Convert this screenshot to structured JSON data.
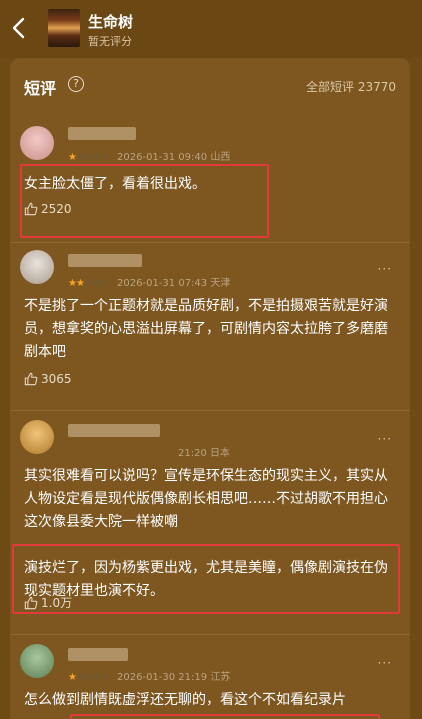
{
  "header": {
    "title": "生命树",
    "subtitle": "暂无评分"
  },
  "section": {
    "title": "短评",
    "all_label": "全部短评",
    "all_count": "23770"
  },
  "reviews": [
    {
      "stars_filled": 1,
      "date": "2026-01-31 09:40",
      "location": "山西",
      "text": "女主脸太僵了，看着很出戏。",
      "likes": "2520"
    },
    {
      "stars_filled": 2,
      "date": "2026-01-31 07:43",
      "location": "天津",
      "text": "不是挑了一个正题材就是品质好剧，不是拍摄艰苦就是好演员，想拿奖的心思溢出屏幕了，可剧情内容太拉胯了多磨磨剧本吧",
      "likes": "3065"
    },
    {
      "stars_filled": 0,
      "date": "21:20",
      "location": "日本",
      "text_a": "其实很难看可以说吗？宣传是环保生态的现实主义，其实从人物设定看是现代版偶像剧长相思吧……不过胡歌不用担心这次像县委大院一样被嘲",
      "text_b": "演技烂了，因为杨紫更出戏，尤其是美瞳，偶像剧演技在伪现实题材里也演不好。",
      "likes": "1.0万"
    },
    {
      "stars_filled": 1,
      "date": "2026-01-30 21:19",
      "location": "江苏",
      "text": "怎么做到剧情既虚浮还无聊的，看这个不如看纪录片",
      "likes": ""
    }
  ],
  "more_label": "···",
  "colors": {
    "highlight": "#e23a3a",
    "star": "#f6a623",
    "bg": "#6e4a15"
  }
}
